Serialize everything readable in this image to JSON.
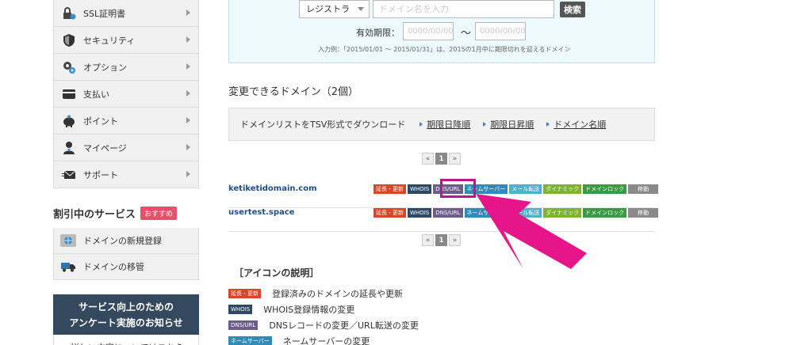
{
  "sidebar": {
    "menu": [
      {
        "label": "SSL証明書",
        "icon": "ssl-lock-icon"
      },
      {
        "label": "セキュリティ",
        "icon": "shield-icon"
      },
      {
        "label": "オプション",
        "icon": "gear-icon"
      },
      {
        "label": "支払い",
        "icon": "credit-card-icon"
      },
      {
        "label": "ポイント",
        "icon": "piggy-bank-icon"
      },
      {
        "label": "マイページ",
        "icon": "user-icon"
      },
      {
        "label": "サポート",
        "icon": "mail-icon"
      }
    ],
    "discount_title": "割引中のサービス",
    "discount_badge": "おすすめ",
    "discount_items": [
      {
        "label": "ドメインの新規登録",
        "icon": "globe-icon"
      },
      {
        "label": "ドメインの移管",
        "icon": "truck-icon"
      }
    ],
    "survey_line1": "サービス向上のための",
    "survey_line2": "アンケート実施のお知らせ",
    "survey_detail": "・詳しい内容についてはこちら"
  },
  "search": {
    "registrar_label": "レジストラ",
    "domain_placeholder": "ドメイン名を入力",
    "search_button": "検索",
    "expiry_label": "有効期限：",
    "date_from_placeholder": "0000/00/00",
    "date_to_placeholder": "0000/00/00",
    "tilde": "〜",
    "example": "入力例：「2015/01/01 〜 2015/01/31」は、2015の1月中に期限切れを迎えるドメイン"
  },
  "domains_section": {
    "title": "変更できるドメイン（2個）",
    "download_label": "ドメインリストをTSV形式でダウンロード",
    "download_links": [
      "期限日降順",
      "期限日昇順",
      "ドメイン名順"
    ],
    "pager": {
      "prev": "«",
      "current": "1",
      "next": "»"
    },
    "rows": [
      {
        "name": "ketiketidomain.com"
      },
      {
        "name": "usertest.space"
      }
    ],
    "tags": [
      {
        "label": "延長・更新",
        "color": "#d9452b"
      },
      {
        "label": "WHOIS",
        "color": "#2c4a66"
      },
      {
        "label": "DNS/URL",
        "color": "#6c5c8c"
      },
      {
        "label": "ネームサーバー",
        "color": "#2f8bb8"
      },
      {
        "label": "メール転送",
        "color": "#4eb0c9"
      },
      {
        "label": "ダイナミック",
        "color": "#7cb32f"
      },
      {
        "label": "ドメインロック",
        "color": "#3a9a44"
      },
      {
        "label": "移動",
        "color": "#8a8a8a"
      }
    ]
  },
  "legend": {
    "title": "［アイコンの説明］",
    "rows": [
      {
        "tag": "延長・更新",
        "color": "#d9452b",
        "desc": "登録済みのドメインの延長や更新"
      },
      {
        "tag": "WHOIS",
        "color": "#2c4a66",
        "desc": "WHOIS登録情報の変更"
      },
      {
        "tag": "DNS/URL",
        "color": "#6c5c8c",
        "desc": "DNSレコードの変更／URL転送の変更"
      },
      {
        "tag": "ネームサーバー",
        "color": "#2f8bb8",
        "desc": "ネームサーバーの変更"
      }
    ]
  },
  "annotation": {
    "highlight_color": "#c01589",
    "arrow_color": "#e6158a"
  }
}
